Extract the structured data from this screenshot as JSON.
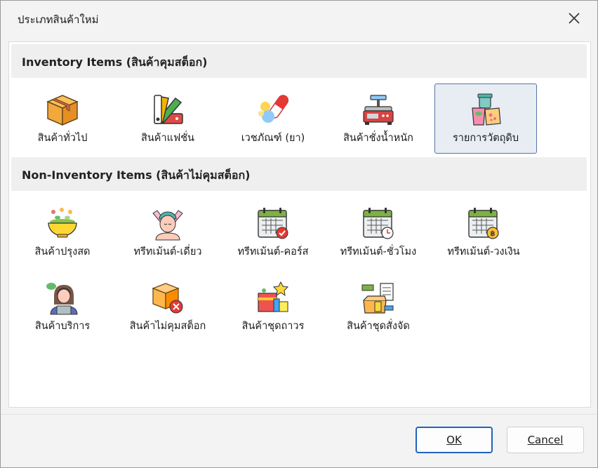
{
  "window": {
    "title": "ประเภทสินค้าใหม่"
  },
  "inventory": {
    "header": "Inventory Items (สินค้าคุมสต็อก)",
    "items": [
      {
        "label": "สินค้าทั่วไป",
        "icon": "box-icon"
      },
      {
        "label": "สินค้าแฟชั่น",
        "icon": "color-swatch-icon"
      },
      {
        "label": "เวชภัณฑ์ (ยา)",
        "icon": "pills-icon"
      },
      {
        "label": "สินค้าชั่งน้ำหนัก",
        "icon": "weighing-scale-icon"
      },
      {
        "label": "รายการวัตถุดิบ",
        "icon": "raw-materials-icon",
        "selected": true
      }
    ]
  },
  "noninventory": {
    "header": "Non-Inventory Items (สินค้าไม่คุมสต็อก)",
    "items": [
      {
        "label": "สินค้าปรุงสด",
        "icon": "salad-bowl-icon"
      },
      {
        "label": "ทรีทเม้นต์-เดี่ยว",
        "icon": "spa-face-icon"
      },
      {
        "label": "ทรีทเม้นต์-คอร์ส",
        "icon": "calendar-check-icon"
      },
      {
        "label": "ทรีทเม้นต์-ชั่วโมง",
        "icon": "calendar-clock-icon"
      },
      {
        "label": "ทรีทเม้นต์-วงเงิน",
        "icon": "calendar-coin-icon"
      },
      {
        "label": "สินค้าบริการ",
        "icon": "service-agent-icon"
      },
      {
        "label": "สินค้าไม่คุมสต็อก",
        "icon": "box-cancel-icon"
      },
      {
        "label": "สินค้าชุดถาวร",
        "icon": "gift-set-icon"
      },
      {
        "label": "สินค้าชุดสั่งจัด",
        "icon": "custom-set-icon"
      }
    ]
  },
  "buttons": {
    "ok": "OK",
    "cancel": "Cancel"
  },
  "colors": {
    "selected_bg": "#e8ecf3",
    "selected_border": "#5575a9",
    "ok_border": "#2062bf"
  }
}
